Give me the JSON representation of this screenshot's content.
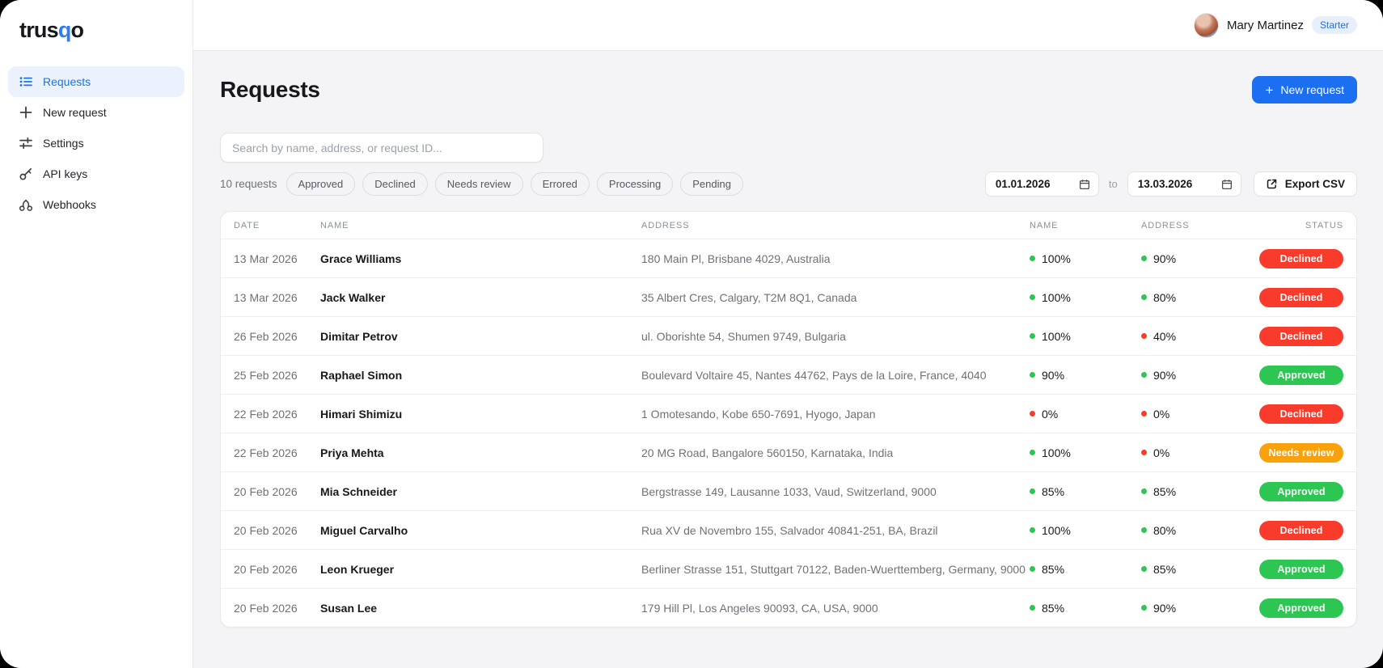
{
  "brand": {
    "prefix": "trus",
    "accent": "q",
    "suffix": "o"
  },
  "sidebar": {
    "items": [
      {
        "label": "Requests",
        "active": true
      },
      {
        "label": "New request",
        "active": false
      },
      {
        "label": "Settings",
        "active": false
      },
      {
        "label": "API keys",
        "active": false
      },
      {
        "label": "Webhooks",
        "active": false
      }
    ]
  },
  "header": {
    "user_name": "Mary Martinez",
    "plan_badge": "Starter"
  },
  "toolbar": {
    "title": "Requests",
    "new_request_label": "New request",
    "search_placeholder": "Search by name, address, or request ID...",
    "count_label": "10 requests",
    "filters": [
      "Approved",
      "Declined",
      "Needs review",
      "Errored",
      "Processing",
      "Pending"
    ],
    "date_from": "01.01.2026",
    "to_label": "to",
    "date_to": "13.03.2026",
    "export_label": "Export CSV"
  },
  "table": {
    "columns": [
      "DATE",
      "NAME",
      "ADDRESS",
      "NAME",
      "ADDRESS",
      "STATUS"
    ],
    "rows": [
      {
        "date": "13 Mar 2026",
        "name": "Grace Williams",
        "address": "180 Main Pl, Brisbane 4029, Australia",
        "name_match": "100%",
        "name_dot": "green",
        "address_match": "90%",
        "address_dot": "green",
        "status": "Declined"
      },
      {
        "date": "13 Mar 2026",
        "name": "Jack Walker",
        "address": "35 Albert Cres, Calgary, T2M 8Q1, Canada",
        "name_match": "100%",
        "name_dot": "green",
        "address_match": "80%",
        "address_dot": "green",
        "status": "Declined"
      },
      {
        "date": "26 Feb 2026",
        "name": "Dimitar Petrov",
        "address": "ul. Oborishte 54, Shumen 9749, Bulgaria",
        "name_match": "100%",
        "name_dot": "green",
        "address_match": "40%",
        "address_dot": "red",
        "status": "Declined"
      },
      {
        "date": "25 Feb 2026",
        "name": "Raphael Simon",
        "address": "Boulevard Voltaire 45, Nantes 44762, Pays de la Loire, France, 4040",
        "name_match": "90%",
        "name_dot": "green",
        "address_match": "90%",
        "address_dot": "green",
        "status": "Approved"
      },
      {
        "date": "22 Feb 2026",
        "name": "Himari Shimizu",
        "address": "1 Omotesando, Kobe 650-7691, Hyogo, Japan",
        "name_match": "0%",
        "name_dot": "red",
        "address_match": "0%",
        "address_dot": "red",
        "status": "Declined"
      },
      {
        "date": "22 Feb 2026",
        "name": "Priya Mehta",
        "address": "20 MG Road, Bangalore 560150, Karnataka, India",
        "name_match": "100%",
        "name_dot": "green",
        "address_match": "0%",
        "address_dot": "red",
        "status": "Needs review"
      },
      {
        "date": "20 Feb 2026",
        "name": "Mia Schneider",
        "address": "Bergstrasse 149, Lausanne 1033, Vaud, Switzerland, 9000",
        "name_match": "85%",
        "name_dot": "green",
        "address_match": "85%",
        "address_dot": "green",
        "status": "Approved"
      },
      {
        "date": "20 Feb 2026",
        "name": "Miguel Carvalho",
        "address": "Rua XV de Novembro 155, Salvador 40841-251, BA, Brazil",
        "name_match": "100%",
        "name_dot": "green",
        "address_match": "80%",
        "address_dot": "green",
        "status": "Declined"
      },
      {
        "date": "20 Feb 2026",
        "name": "Leon Krueger",
        "address": "Berliner Strasse 151, Stuttgart 70122, Baden-Wuerttemberg, Germany, 9000",
        "name_match": "85%",
        "name_dot": "green",
        "address_match": "85%",
        "address_dot": "green",
        "status": "Approved"
      },
      {
        "date": "20 Feb 2026",
        "name": "Susan Lee",
        "address": "179 Hill Pl, Los Angeles 90093, CA, USA, 9000",
        "name_match": "85%",
        "name_dot": "green",
        "address_match": "90%",
        "address_dot": "green",
        "status": "Approved"
      }
    ]
  },
  "colors": {
    "accent_blue": "#1a73e8",
    "status": {
      "Declined": "#f93b2b",
      "Approved": "#2dc653",
      "Needs review": "#f9a10a"
    },
    "dot": {
      "green": "#2dc653",
      "red": "#f93b2b"
    }
  }
}
